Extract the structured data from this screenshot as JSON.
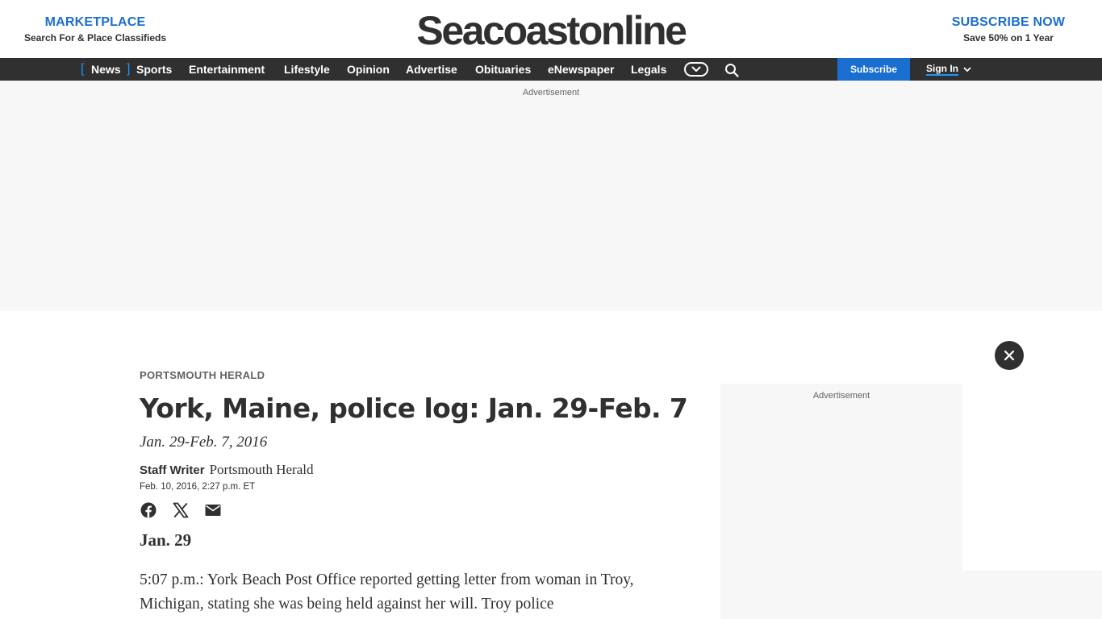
{
  "header": {
    "marketplace_title": "MARKETPLACE",
    "marketplace_subtitle": "Search For & Place Classifieds",
    "logo": "Seacoastonline",
    "subscribe_title": "SUBSCRIBE NOW",
    "subscribe_subtitle": "Save 50% on 1 Year"
  },
  "nav": {
    "items": [
      {
        "label": "News",
        "active": true
      },
      {
        "label": "Sports"
      },
      {
        "label": "Entertainment"
      },
      {
        "label": "Lifestyle"
      },
      {
        "label": "Opinion"
      },
      {
        "label": "Advertise"
      },
      {
        "label": "Obituaries"
      },
      {
        "label": "eNewspaper"
      },
      {
        "label": "Legals"
      }
    ],
    "bracket_open": "[",
    "bracket_close": "]",
    "more_icon": "chevron-down-icon",
    "search_icon": "search-icon",
    "subscribe_label": "Subscribe",
    "signin_label": "Sign In"
  },
  "ads": {
    "top_label": "Advertisement",
    "side_label": "Advertisement"
  },
  "article": {
    "source_label": "PORTSMOUTH HERALD",
    "headline": "York, Maine, police log: Jan. 29-Feb. 7",
    "subhead": "Jan. 29-Feb. 7, 2016",
    "author": "Staff Writer",
    "publication": "Portsmouth Herald",
    "date": "Feb. 10, 2016, 2:27 p.m. ET",
    "share": {
      "facebook_icon": "facebook-icon",
      "x_icon": "x-icon",
      "email_icon": "email-icon"
    },
    "section_heading": "Jan. 29",
    "body_paragraph": "5:07 p.m.: York Beach Post Office reported getting letter from woman in Troy, Michigan, stating she was being held against her will. Troy police"
  },
  "colors": {
    "brand_blue": "#1a6ed0",
    "accent_blue": "#1a98ff",
    "nav_bg": "#303030",
    "text": "#303030",
    "ad_bg": "#f7f7f7"
  }
}
